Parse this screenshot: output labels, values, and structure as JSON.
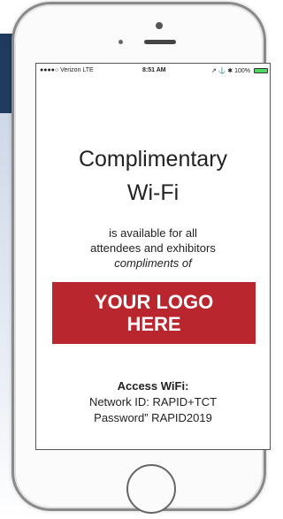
{
  "status_bar": {
    "carrier": "●●●●○ Verizon  LTE",
    "time": "8:51 AM",
    "indicators": "↗ ⚓ ✱ 100%",
    "battery_level": 1.0
  },
  "title_line1": "Complimentary",
  "title_line2": "Wi-Fi",
  "subtitle_line1": "is available for all",
  "subtitle_line2": "attendees and exhibitors",
  "subtitle_line3": "compliments of",
  "logo_line1": "YOUR LOGO",
  "logo_line2": "HERE",
  "access": {
    "title": "Access WiFi:",
    "network": "Network ID: RAPID+TCT",
    "password": "Password” RAPID2019"
  },
  "colors": {
    "logo_bg": "#b9262e",
    "background_band": "#1f3a5c"
  },
  "icons": [
    "camera-icon",
    "earpiece-icon",
    "home-button-icon",
    "battery-icon"
  ]
}
